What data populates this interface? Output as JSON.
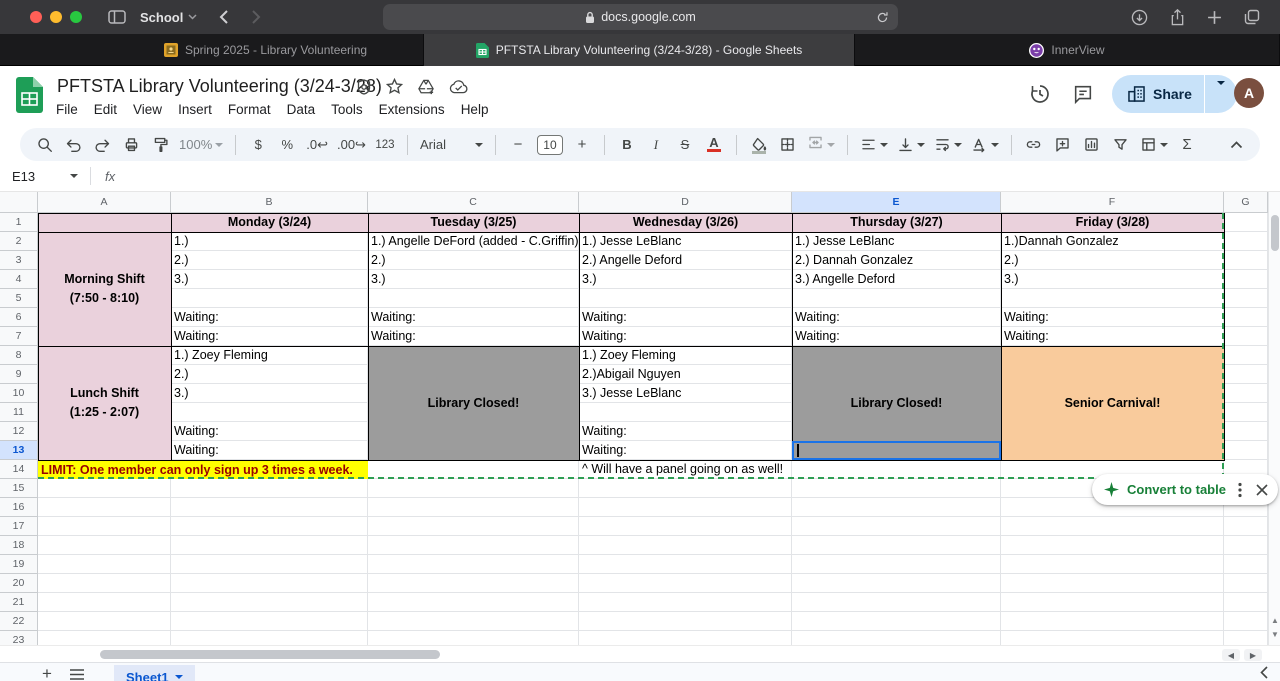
{
  "chrome": {
    "profile_label": "School",
    "url": "docs.google.com",
    "tabs": [
      {
        "label": "Spring 2025 - Library Volunteering",
        "favicon": "classroom-favicon",
        "active": false
      },
      {
        "label": "PFTSTA Library Volunteering (3/24-3/28) - Google Sheets",
        "favicon": "sheets-favicon",
        "active": true
      },
      {
        "label": "InnerView",
        "favicon": "innerview-favicon",
        "active": false
      }
    ]
  },
  "header": {
    "title": "PFTSTA Library Volunteering (3/24-3/28)",
    "menus": [
      "File",
      "Edit",
      "View",
      "Insert",
      "Format",
      "Data",
      "Tools",
      "Extensions",
      "Help"
    ],
    "title_icons": [
      "at-badge-icon",
      "star-icon",
      "drive-add-icon",
      "cloud-saved-icon"
    ],
    "share_label": "Share",
    "avatar_initial": "A"
  },
  "toolbar": {
    "zoom": "100%",
    "currency": "$",
    "percent": "%",
    "decimal_decrease": ".0",
    "decimal_increase": ".00",
    "more_formats": "123",
    "font": "Arial",
    "font_size": "10",
    "bold": "B",
    "italic": "I",
    "strike": "S",
    "text_color": "A",
    "sum": "Σ",
    "items": [
      "search",
      "undo",
      "redo",
      "print",
      "paint-format",
      "zoom-select",
      "div",
      "currency",
      "percent",
      "decimal-decrease",
      "decimal-increase",
      "more-formats",
      "div",
      "font-select",
      "div",
      "size-minus",
      "size-box",
      "size-plus",
      "div",
      "bold",
      "italic",
      "strikethrough",
      "text-color",
      "div",
      "fill-color",
      "borders",
      "merge-cells",
      "div",
      "align-left",
      "valign-bottom",
      "text-wrap",
      "text-rotate",
      "div",
      "link",
      "comment-add",
      "chart",
      "filter",
      "table-views",
      "sum"
    ]
  },
  "formula_bar": {
    "cell_ref": "E13",
    "fx_label": "fx"
  },
  "convert_pill": {
    "label": "Convert to table"
  },
  "bottom_bar": {
    "sheet_tab": "Sheet1"
  },
  "grid": {
    "col_letters": [
      "A",
      "B",
      "C",
      "D",
      "E",
      "F",
      "G"
    ],
    "row_count": 23,
    "selected_cell": "E13",
    "colors": {
      "pink": "#ead1dc",
      "gray": "#9c9c9c",
      "orange": "#f9cb9c",
      "yellow": "#ffff00",
      "dark_red": "#990000"
    },
    "cells": {
      "B1": {
        "t": "Monday (3/24)",
        "b": 1,
        "al": "c",
        "bg": "pink"
      },
      "C1": {
        "t": "Tuesday (3/25)",
        "b": 1,
        "al": "c",
        "bg": "pink"
      },
      "D1": {
        "t": "Wednesday (3/26)",
        "b": 1,
        "al": "c",
        "bg": "pink"
      },
      "E1": {
        "t": "Thursday (3/27)",
        "b": 1,
        "al": "c",
        "bg": "pink"
      },
      "F1": {
        "t": "Friday (3/28)",
        "b": 1,
        "al": "c",
        "bg": "pink"
      },
      "A4": {
        "t": "Morning Shift",
        "b": 1,
        "al": "c"
      },
      "A5": {
        "t": "(7:50 - 8:10)",
        "b": 1,
        "al": "c"
      },
      "A10": {
        "t": "Lunch Shift",
        "b": 1,
        "al": "c"
      },
      "A11": {
        "t": "(1:25 - 2:07)",
        "b": 1,
        "al": "c"
      },
      "B2": {
        "t": "1.)"
      },
      "B3": {
        "t": "2.)"
      },
      "B4": {
        "t": "3.)"
      },
      "B6": {
        "t": "Waiting:"
      },
      "B7": {
        "t": "Waiting:"
      },
      "B8": {
        "t": "1.) Zoey Fleming"
      },
      "B9": {
        "t": "2.)"
      },
      "B10": {
        "t": "3.)"
      },
      "B12": {
        "t": "Waiting:"
      },
      "B13": {
        "t": "Waiting:"
      },
      "C2": {
        "t": "1.) Angelle DeFord (added - C.Griffin)"
      },
      "C3": {
        "t": "2.)"
      },
      "C4": {
        "t": "3.)"
      },
      "C6": {
        "t": "Waiting:"
      },
      "C7": {
        "t": "Waiting:"
      },
      "D2": {
        "t": "1.) Jesse LeBlanc"
      },
      "D3": {
        "t": "2.) Angelle Deford"
      },
      "D4": {
        "t": "3.)"
      },
      "D6": {
        "t": "Waiting:"
      },
      "D7": {
        "t": "Waiting:"
      },
      "D8": {
        "t": "1.) Zoey Fleming"
      },
      "D9": {
        "t": "2.)Abigail Nguyen"
      },
      "D10": {
        "t": "3.) Jesse LeBlanc"
      },
      "D12": {
        "t": "Waiting:"
      },
      "D13": {
        "t": "Waiting:"
      },
      "D14": {
        "t": "^ Will have a panel going on as well!"
      },
      "E2": {
        "t": "1.) Jesse LeBlanc"
      },
      "E3": {
        "t": "2.) Dannah Gonzalez"
      },
      "E4": {
        "t": "3.) Angelle Deford"
      },
      "E6": {
        "t": "Waiting:"
      },
      "E7": {
        "t": "Waiting:"
      },
      "F2": {
        "t": "1.)Dannah Gonzalez"
      },
      "F3": {
        "t": "2.)"
      },
      "F4": {
        "t": "3.)"
      },
      "F6": {
        "t": "Waiting:"
      },
      "F7": {
        "t": "Waiting:"
      }
    },
    "merges": [
      {
        "range": "A1:A13",
        "text": "",
        "bg": "pink"
      },
      {
        "range": "C8:C13",
        "text": "Library Closed!",
        "bg": "gray",
        "bold": true
      },
      {
        "range": "E8:E13",
        "text": "Library Closed!",
        "bg": "gray",
        "bold": true
      },
      {
        "range": "F8:F13",
        "text": "Senior Carnival!",
        "bg": "orange",
        "bold": true
      },
      {
        "range": "A14:B14",
        "text": "LIMIT: One member can only sign up 3 times a week.",
        "bg": "yellow",
        "bold": true,
        "color": "dark_red",
        "align": "left"
      }
    ]
  }
}
